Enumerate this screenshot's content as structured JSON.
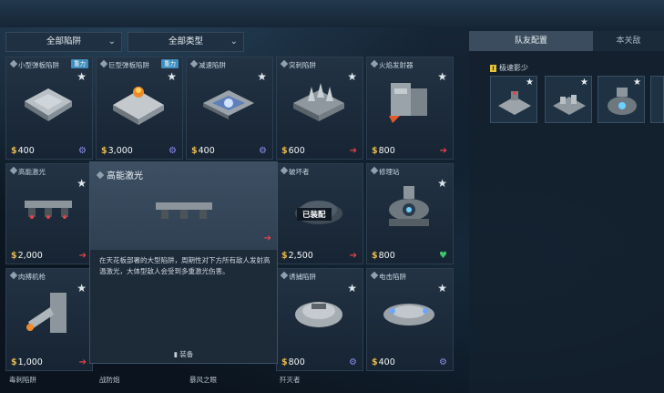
{
  "filters": {
    "traps": "全部陷阱",
    "types": "全部类型"
  },
  "right_panel": {
    "tab_team": "队友配置",
    "tab_level": "本关敌",
    "section_title": "极速影少",
    "section_badge": "!",
    "slots": [
      {
        "name": "trap-a"
      },
      {
        "name": "trap-b"
      },
      {
        "name": "trap-c"
      }
    ]
  },
  "cards": [
    {
      "name": "小型弹板陷阱",
      "tag": "重力",
      "price": "400",
      "action": "gear"
    },
    {
      "name": "巨型弹板陷阱",
      "tag": "重力",
      "price": "3,000",
      "action": "gear"
    },
    {
      "name": "减速陷阱",
      "tag": "",
      "price": "400",
      "action": "gear"
    },
    {
      "name": "突刺陷阱",
      "tag": "",
      "price": "600",
      "action": "arrow"
    },
    {
      "name": "火焰发射器",
      "tag": "",
      "price": "800",
      "action": "arrow"
    },
    {
      "name": "高能激光",
      "tag": "",
      "price": "2,000",
      "action": "arrow"
    },
    {
      "name": "破坏者",
      "tag": "",
      "price": "2,500",
      "action": "arrow",
      "equipped": "已装配"
    },
    {
      "name": "修理站",
      "tag": "",
      "price": "800",
      "action": "heart"
    },
    {
      "name": "肉搏机枪",
      "tag": "",
      "price": "1,000",
      "action": "arrow"
    },
    {
      "name": "诱捕陷阱",
      "tag": "",
      "price": "800",
      "action": "gear"
    },
    {
      "name": "电击陷阱",
      "tag": "",
      "price": "400",
      "action": "gear"
    }
  ],
  "bottom_row": [
    "毒刺陷阱",
    "战防炮",
    "暴风之眼",
    "歼灭者"
  ],
  "tooltip": {
    "title": "高能激光",
    "description": "在天花板部署的大型陷阱，周期性对下方所有敌人发射高温激光，大体型敌人会受到多重激光伤害。",
    "equip": "装备"
  },
  "colors": {
    "coin": "#e6b84a",
    "arrow": "#e0434b",
    "gear": "#8e8ef0",
    "heart": "#42c36b",
    "tag": "#3d8fc0"
  }
}
